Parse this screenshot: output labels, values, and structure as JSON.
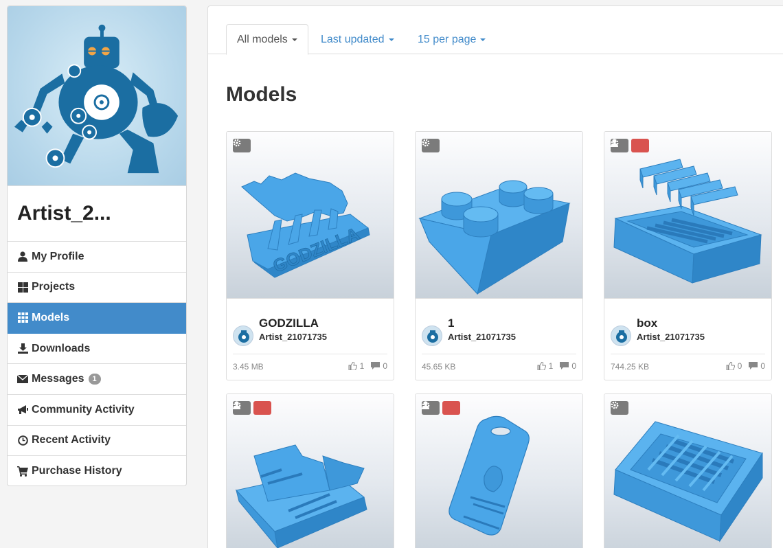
{
  "profile": {
    "username": "Artist_2..."
  },
  "nav": [
    {
      "label": "My Profile",
      "icon": "user-icon"
    },
    {
      "label": "Projects",
      "icon": "projects-icon"
    },
    {
      "label": "Models",
      "icon": "grid-icon"
    },
    {
      "label": "Downloads",
      "icon": "download-icon"
    },
    {
      "label": "Messages",
      "icon": "envelope-icon",
      "badge": "1"
    },
    {
      "label": "Community Activity",
      "icon": "megaphone-icon"
    },
    {
      "label": "Recent Activity",
      "icon": "clock-icon"
    },
    {
      "label": "Purchase History",
      "icon": "cart-icon"
    }
  ],
  "tabs": {
    "all": "All models",
    "updated": "Last updated",
    "per_page": "15 per page"
  },
  "page_title": "Models",
  "models": [
    {
      "title": "GODZILLA",
      "author": "Artist_21071735",
      "size": "3.45 MB",
      "likes": "1",
      "comments": "0"
    },
    {
      "title": "1",
      "author": "Artist_21071735",
      "size": "45.65 KB",
      "likes": "1",
      "comments": "0"
    },
    {
      "title": "box",
      "author": "Artist_21071735",
      "size": "744.25 KB",
      "likes": "0",
      "comments": "0"
    }
  ],
  "colors": {
    "accent": "#428bca",
    "model_blue": "#4aa6e8",
    "danger": "#d9534f"
  }
}
